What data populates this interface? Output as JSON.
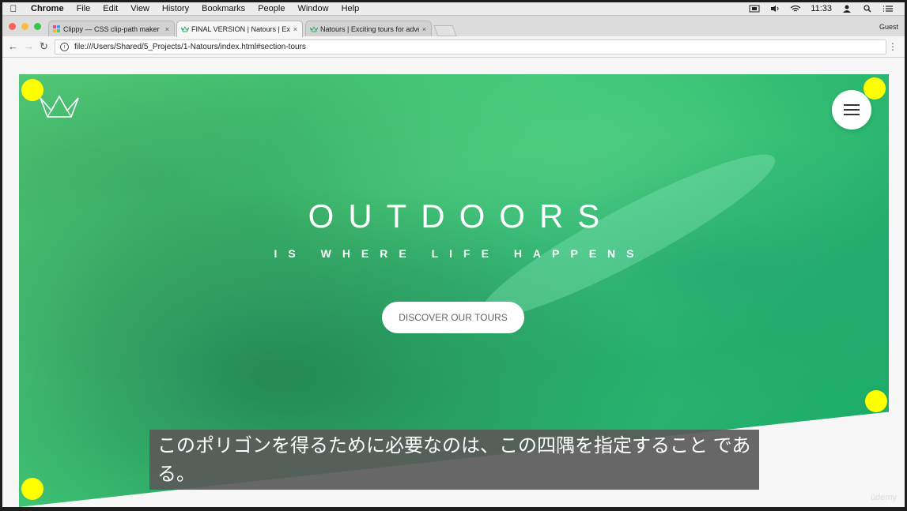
{
  "menubar": {
    "app": "Chrome",
    "items": [
      "File",
      "Edit",
      "View",
      "History",
      "Bookmarks",
      "People",
      "Window",
      "Help"
    ],
    "time": "11:33"
  },
  "tabs": [
    {
      "title": "Clippy — CSS clip-path maker",
      "close": "×"
    },
    {
      "title": "FINAL VERSION | Natours | Exciting tours",
      "close": "×"
    },
    {
      "title": "Natours | Exciting tours for adventurous",
      "close": "×"
    }
  ],
  "guest_label": "Guest",
  "address": "file:///Users/Shared/5_Projects/1-Natours/index.html#section-tours",
  "hero": {
    "title": "OUTDOORS",
    "subtitle": "IS WHERE LIFE HAPPENS",
    "cta": "DISCOVER OUR TOURS"
  },
  "caption": "このポリゴンを得るために必要なのは、この四隅を指定すること である。",
  "watermark": "ûdemy",
  "colors": {
    "hero_green_light": "#5dd67f",
    "hero_green_dark": "#19a868",
    "corner_marker": "#ffff00"
  }
}
